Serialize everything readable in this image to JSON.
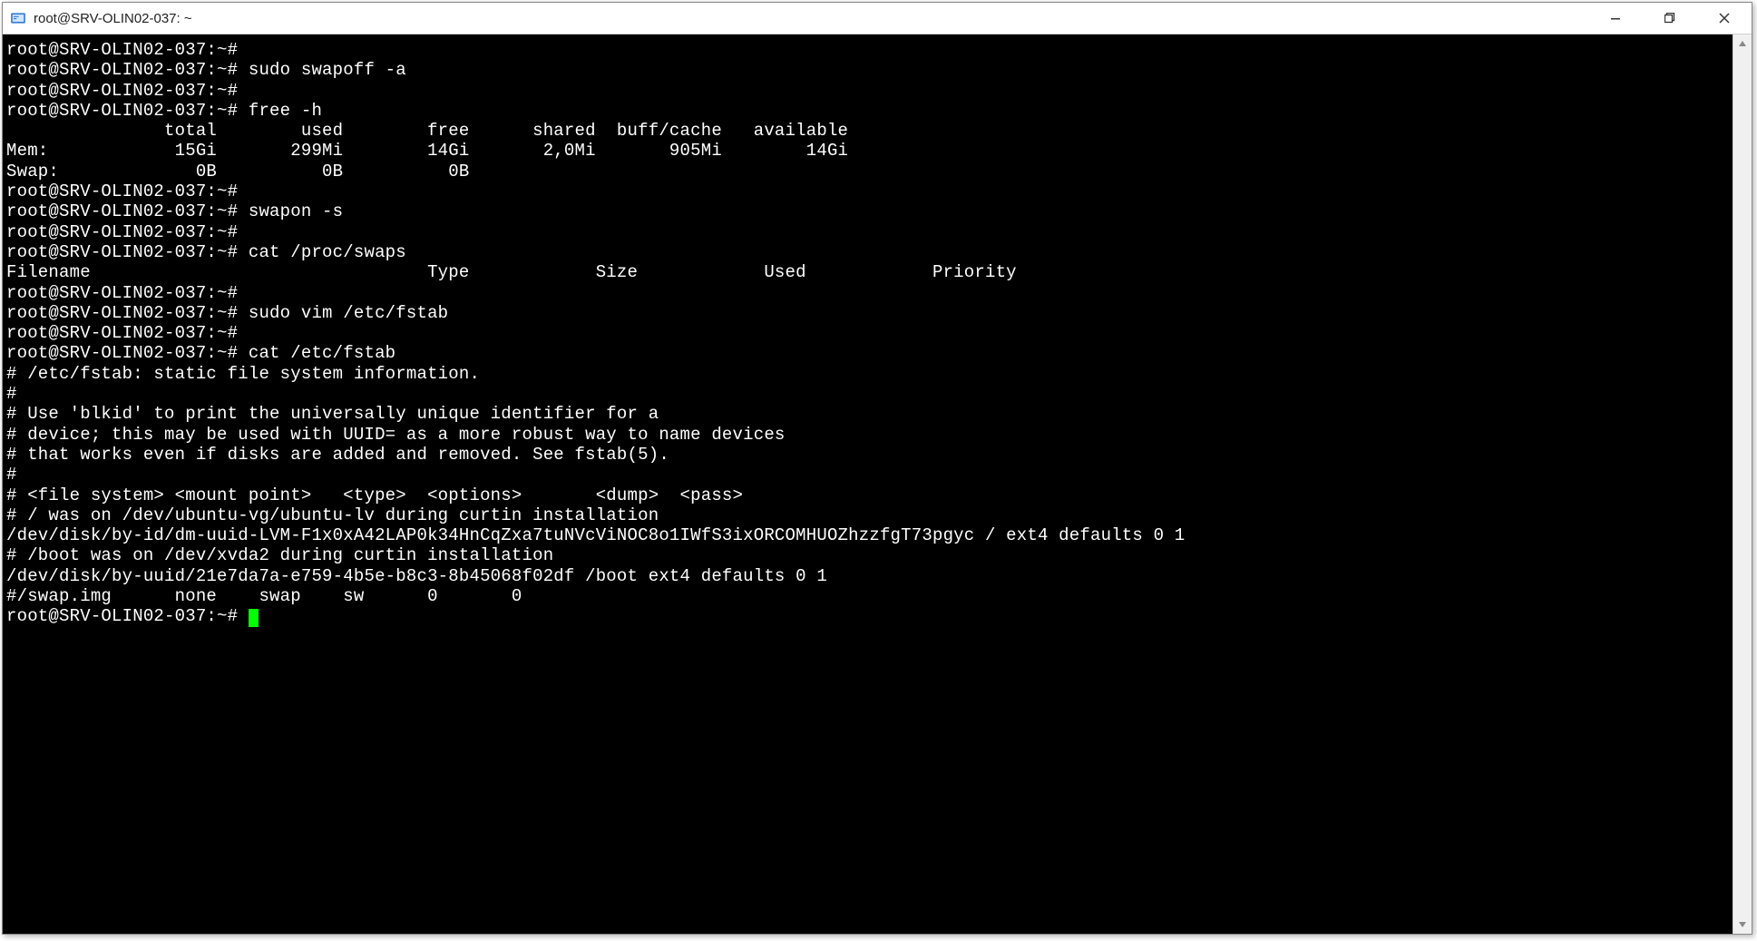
{
  "window": {
    "title": "root@SRV-OLIN02-037: ~"
  },
  "prompt": "root@SRV-OLIN02-037:~#",
  "lines": {
    "l0": "root@SRV-OLIN02-037:~#",
    "l1": "root@SRV-OLIN02-037:~# sudo swapoff -a",
    "l2": "root@SRV-OLIN02-037:~#",
    "l3": "root@SRV-OLIN02-037:~# free -h",
    "l4": "               total        used        free      shared  buff/cache   available",
    "l5": "Mem:            15Gi       299Mi        14Gi       2,0Mi       905Mi        14Gi",
    "l6": "Swap:             0B          0B          0B",
    "l7": "root@SRV-OLIN02-037:~#",
    "l8": "root@SRV-OLIN02-037:~# swapon -s",
    "l9": "root@SRV-OLIN02-037:~#",
    "l10": "root@SRV-OLIN02-037:~# cat /proc/swaps",
    "l11": "Filename                                Type            Size            Used            Priority",
    "l12": "root@SRV-OLIN02-037:~#",
    "l13": "root@SRV-OLIN02-037:~# sudo vim /etc/fstab",
    "l14": "root@SRV-OLIN02-037:~#",
    "l15": "root@SRV-OLIN02-037:~# cat /etc/fstab",
    "l16": "# /etc/fstab: static file system information.",
    "l17": "#",
    "l18": "# Use 'blkid' to print the universally unique identifier for a",
    "l19": "# device; this may be used with UUID= as a more robust way to name devices",
    "l20": "# that works even if disks are added and removed. See fstab(5).",
    "l21": "#",
    "l22": "# <file system> <mount point>   <type>  <options>       <dump>  <pass>",
    "l23": "# / was on /dev/ubuntu-vg/ubuntu-lv during curtin installation",
    "l24": "/dev/disk/by-id/dm-uuid-LVM-F1x0xA42LAP0k34HnCqZxa7tuNVcViNOC8o1IWfS3ixORCOMHUOZhzzfgT73pgyc / ext4 defaults 0 1",
    "l25": "# /boot was on /dev/xvda2 during curtin installation",
    "l26": "/dev/disk/by-uuid/21e7da7a-e759-4b5e-b8c3-8b45068f02df /boot ext4 defaults 0 1",
    "l27": "#/swap.img      none    swap    sw      0       0",
    "l28": "root@SRV-OLIN02-037:~# "
  }
}
